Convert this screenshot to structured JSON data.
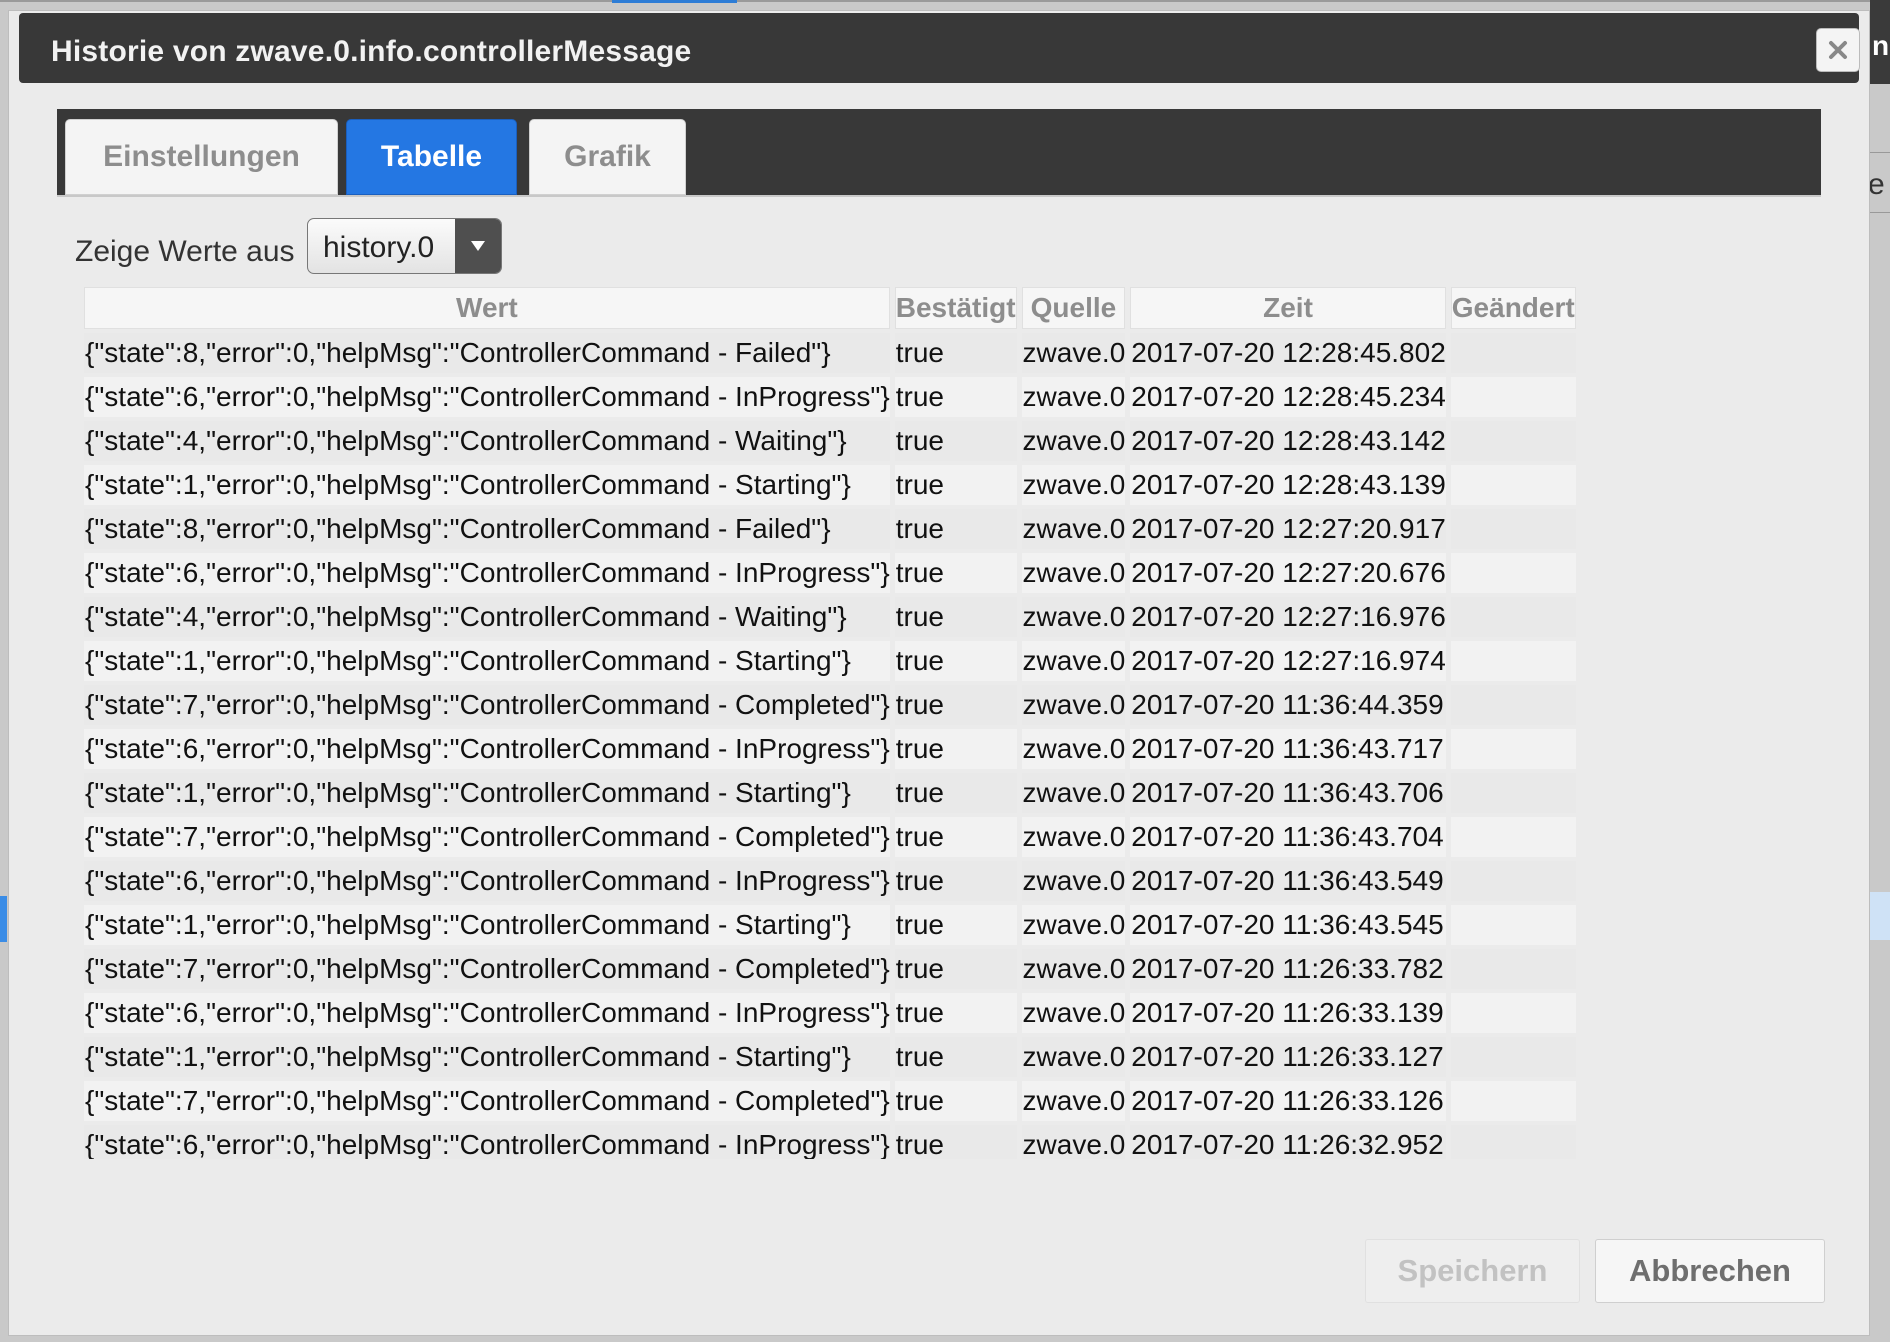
{
  "dialog": {
    "title": "Historie von zwave.0.info.controllerMessage",
    "close_icon": "close-icon"
  },
  "tabs": [
    {
      "label": "Einstellungen",
      "active": false
    },
    {
      "label": "Tabelle",
      "active": true
    },
    {
      "label": "Grafik",
      "active": false
    }
  ],
  "filter": {
    "label": "Zeige Werte aus",
    "selected": "history.0"
  },
  "table": {
    "columns": [
      "Wert",
      "Bestätigt",
      "Quelle",
      "Zeit",
      "Geändert"
    ],
    "rows": [
      {
        "wert": "{\"state\":8,\"error\":0,\"helpMsg\":\"ControllerCommand - Failed\"}",
        "bestaetigt": "true",
        "quelle": "zwave.0",
        "zeit": "2017-07-20 12:28:45.802",
        "geaendert": ""
      },
      {
        "wert": "{\"state\":6,\"error\":0,\"helpMsg\":\"ControllerCommand - InProgress\"}",
        "bestaetigt": "true",
        "quelle": "zwave.0",
        "zeit": "2017-07-20 12:28:45.234",
        "geaendert": ""
      },
      {
        "wert": "{\"state\":4,\"error\":0,\"helpMsg\":\"ControllerCommand - Waiting\"}",
        "bestaetigt": "true",
        "quelle": "zwave.0",
        "zeit": "2017-07-20 12:28:43.142",
        "geaendert": ""
      },
      {
        "wert": "{\"state\":1,\"error\":0,\"helpMsg\":\"ControllerCommand - Starting\"}",
        "bestaetigt": "true",
        "quelle": "zwave.0",
        "zeit": "2017-07-20 12:28:43.139",
        "geaendert": ""
      },
      {
        "wert": "{\"state\":8,\"error\":0,\"helpMsg\":\"ControllerCommand - Failed\"}",
        "bestaetigt": "true",
        "quelle": "zwave.0",
        "zeit": "2017-07-20 12:27:20.917",
        "geaendert": ""
      },
      {
        "wert": "{\"state\":6,\"error\":0,\"helpMsg\":\"ControllerCommand - InProgress\"}",
        "bestaetigt": "true",
        "quelle": "zwave.0",
        "zeit": "2017-07-20 12:27:20.676",
        "geaendert": ""
      },
      {
        "wert": "{\"state\":4,\"error\":0,\"helpMsg\":\"ControllerCommand - Waiting\"}",
        "bestaetigt": "true",
        "quelle": "zwave.0",
        "zeit": "2017-07-20 12:27:16.976",
        "geaendert": ""
      },
      {
        "wert": "{\"state\":1,\"error\":0,\"helpMsg\":\"ControllerCommand - Starting\"}",
        "bestaetigt": "true",
        "quelle": "zwave.0",
        "zeit": "2017-07-20 12:27:16.974",
        "geaendert": ""
      },
      {
        "wert": "{\"state\":7,\"error\":0,\"helpMsg\":\"ControllerCommand - Completed\"}",
        "bestaetigt": "true",
        "quelle": "zwave.0",
        "zeit": "2017-07-20 11:36:44.359",
        "geaendert": ""
      },
      {
        "wert": "{\"state\":6,\"error\":0,\"helpMsg\":\"ControllerCommand - InProgress\"}",
        "bestaetigt": "true",
        "quelle": "zwave.0",
        "zeit": "2017-07-20 11:36:43.717",
        "geaendert": ""
      },
      {
        "wert": "{\"state\":1,\"error\":0,\"helpMsg\":\"ControllerCommand - Starting\"}",
        "bestaetigt": "true",
        "quelle": "zwave.0",
        "zeit": "2017-07-20 11:36:43.706",
        "geaendert": ""
      },
      {
        "wert": "{\"state\":7,\"error\":0,\"helpMsg\":\"ControllerCommand - Completed\"}",
        "bestaetigt": "true",
        "quelle": "zwave.0",
        "zeit": "2017-07-20 11:36:43.704",
        "geaendert": ""
      },
      {
        "wert": "{\"state\":6,\"error\":0,\"helpMsg\":\"ControllerCommand - InProgress\"}",
        "bestaetigt": "true",
        "quelle": "zwave.0",
        "zeit": "2017-07-20 11:36:43.549",
        "geaendert": ""
      },
      {
        "wert": "{\"state\":1,\"error\":0,\"helpMsg\":\"ControllerCommand - Starting\"}",
        "bestaetigt": "true",
        "quelle": "zwave.0",
        "zeit": "2017-07-20 11:36:43.545",
        "geaendert": ""
      },
      {
        "wert": "{\"state\":7,\"error\":0,\"helpMsg\":\"ControllerCommand - Completed\"}",
        "bestaetigt": "true",
        "quelle": "zwave.0",
        "zeit": "2017-07-20 11:26:33.782",
        "geaendert": ""
      },
      {
        "wert": "{\"state\":6,\"error\":0,\"helpMsg\":\"ControllerCommand - InProgress\"}",
        "bestaetigt": "true",
        "quelle": "zwave.0",
        "zeit": "2017-07-20 11:26:33.139",
        "geaendert": ""
      },
      {
        "wert": "{\"state\":1,\"error\":0,\"helpMsg\":\"ControllerCommand - Starting\"}",
        "bestaetigt": "true",
        "quelle": "zwave.0",
        "zeit": "2017-07-20 11:26:33.127",
        "geaendert": ""
      },
      {
        "wert": "{\"state\":7,\"error\":0,\"helpMsg\":\"ControllerCommand - Completed\"}",
        "bestaetigt": "true",
        "quelle": "zwave.0",
        "zeit": "2017-07-20 11:26:33.126",
        "geaendert": ""
      },
      {
        "wert": "{\"state\":6,\"error\":0,\"helpMsg\":\"ControllerCommand - InProgress\"}",
        "bestaetigt": "true",
        "quelle": "zwave.0",
        "zeit": "2017-07-20 11:26:32.952",
        "geaendert": ""
      }
    ]
  },
  "footer": {
    "save_label": "Speichern",
    "cancel_label": "Abbrechen"
  },
  "colors": {
    "accent": "#2477e3",
    "titlebar": "#383838"
  }
}
